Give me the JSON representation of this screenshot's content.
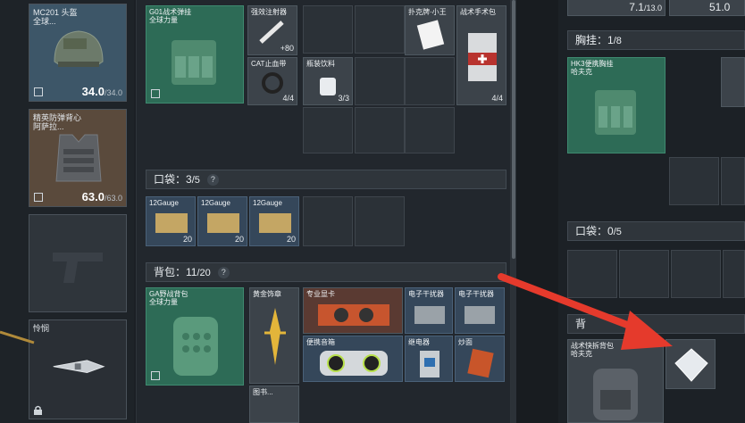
{
  "left": {
    "helmet": {
      "name": "MC201 头盔",
      "sub": "全球...",
      "durability": "34.0",
      "durability_max": "/34.0"
    },
    "armor": {
      "name": "精英防弹背心",
      "sub": "阿萨拉...",
      "durability": "63.0",
      "durability_max": "/63.0"
    },
    "knife": {
      "name": "怜悯"
    }
  },
  "middle": {
    "chest_item": {
      "name": "G01战术弹挂",
      "sub": "全球力量"
    },
    "items_top": [
      {
        "name": "强效注射器",
        "count": "+80"
      },
      {
        "name": "CAT止血带",
        "count": "4/4"
      },
      {
        "name": "瓶装饮料",
        "count": "3/3"
      },
      {
        "name": "扑克牌·小王",
        "count": ""
      },
      {
        "name": "战术手术包",
        "count": "4/4"
      }
    ],
    "pocket": {
      "label": "口袋：",
      "value": "3",
      "max": "/5",
      "help": "?"
    },
    "pocket_items": [
      {
        "name": "12Gauge",
        "count": "20"
      },
      {
        "name": "12Gauge",
        "count": "20"
      },
      {
        "name": "12Gauge",
        "count": "20"
      }
    ],
    "backpack": {
      "label": "背包：",
      "value": "11",
      "max": "/20",
      "help": "?"
    },
    "backpack_item": {
      "name": "GA野战背包",
      "sub": "全球力量"
    },
    "backpack_items": [
      {
        "name": "黄金饰章"
      },
      {
        "name": "专业显卡"
      },
      {
        "name": "电子干扰器"
      },
      {
        "name": "电子干扰器"
      },
      {
        "name": "便携音箱"
      },
      {
        "name": "继电器"
      },
      {
        "name": "炒面"
      },
      {
        "name": "图书..."
      }
    ]
  },
  "right": {
    "top_values": [
      "7.1",
      "/13.0",
      "51.0"
    ],
    "chest": {
      "label": "胸挂：",
      "value": "1",
      "max": "/8"
    },
    "chest_item": {
      "name": "HK3便携胸挂",
      "sub": "哈夫克"
    },
    "pocket": {
      "label": "口袋：",
      "value": "0",
      "max": "/5"
    },
    "backpack_item": {
      "name": "战术快拆背包",
      "sub": "哈夫克"
    },
    "partial_label": "背"
  }
}
